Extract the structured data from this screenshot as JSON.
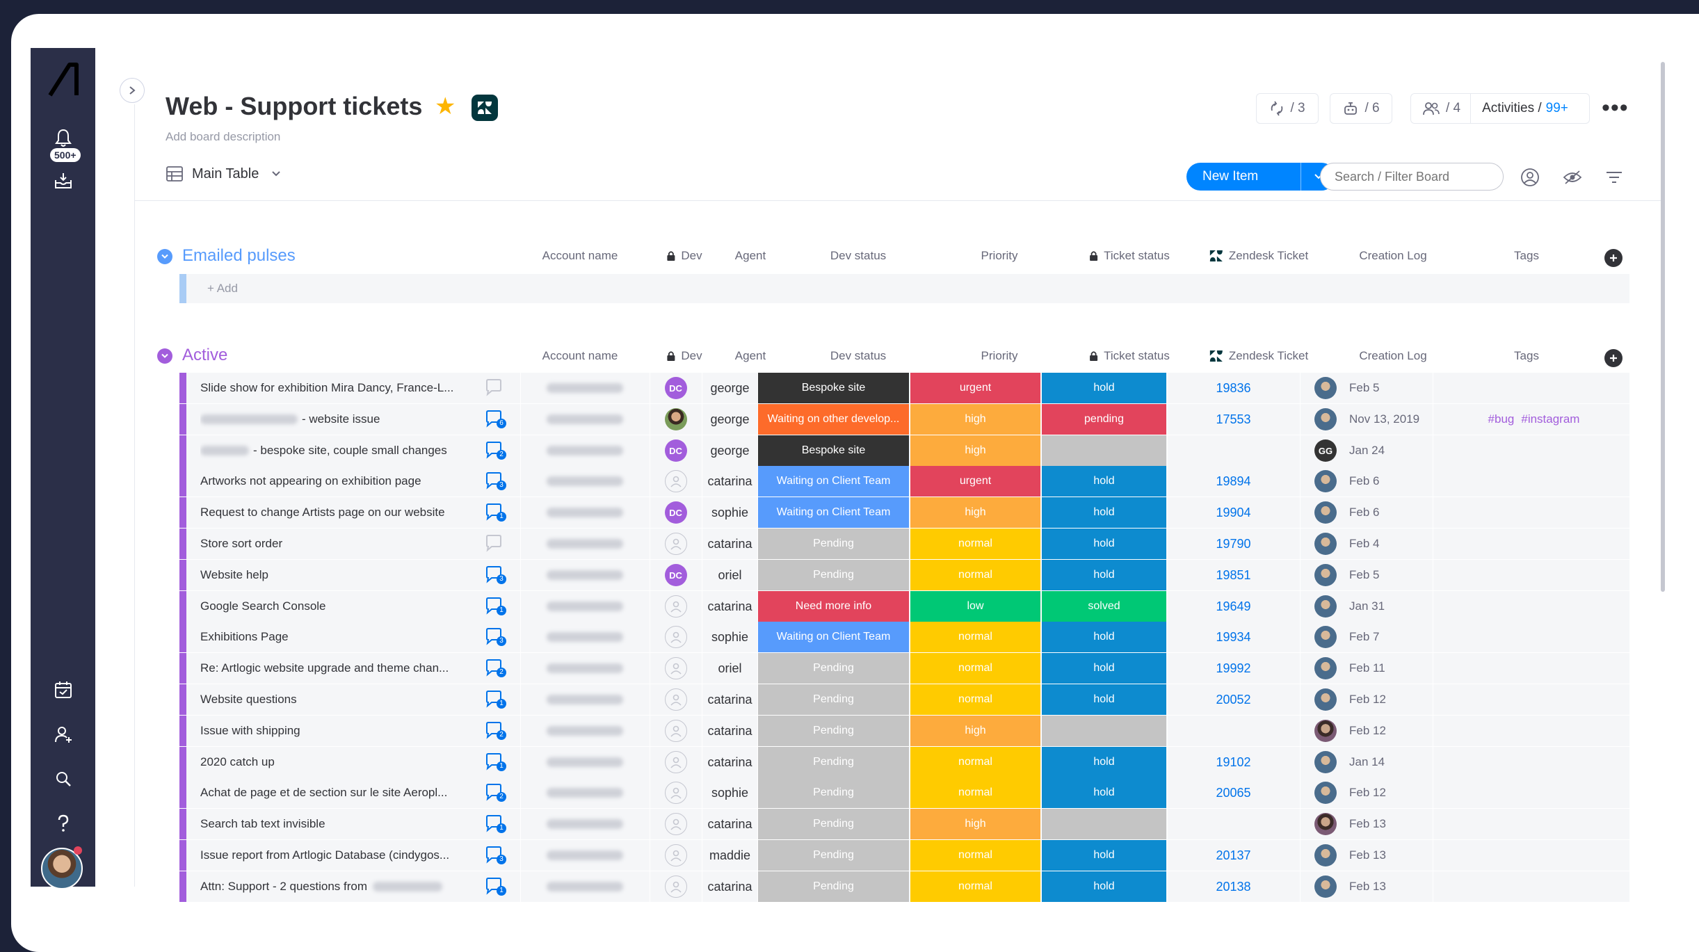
{
  "board": {
    "title": "Web - Support tickets",
    "description_placeholder": "Add board description"
  },
  "nav": {
    "inbox_badge": "500+"
  },
  "header_counters": {
    "automations": "/ 3",
    "integrations": "/ 6",
    "members": "/ 4",
    "activities_label": "Activities /",
    "activities_count": "99+"
  },
  "view": {
    "name": "Main Table"
  },
  "toolbar": {
    "new_item_label": "New Item",
    "search_placeholder": "Search / Filter Board"
  },
  "columns": [
    "Account name",
    "Dev",
    "Agent",
    "Dev status",
    "Priority",
    "Ticket status",
    "Zendesk Ticket",
    "Creation Log",
    "Tags"
  ],
  "groups": [
    {
      "name": "Emailed pulses",
      "color": "#579bfc",
      "add_label": "+ Add"
    },
    {
      "name": "Active",
      "color": "#a25ddc"
    }
  ],
  "colors": {
    "Bespoke site": "#333333",
    "Waiting on other develop...": "#fd6b2a",
    "Waiting on Client Team": "#579bfc",
    "Pending": "#c4c4c4",
    "Need more info": "#e2445c",
    "urgent": "#e2445c",
    "high": "#fdab3d",
    "normal": "#ffcb00",
    "low": "#00c875",
    "hold": "#0d8bcf",
    "pending": "#e2445c",
    "solved": "#00c875"
  },
  "rows": [
    {
      "name": "Slide show for exhibition Mira Dancy, France-L...",
      "updates": "",
      "dev": "DC",
      "agent": "george",
      "dev_status": "Bespoke site",
      "priority": "urgent",
      "ticket_status": "hold",
      "zendesk": "19836",
      "log_avatar": "photo",
      "log_date": "Feb 5",
      "tags": []
    },
    {
      "name": "- website issue",
      "name_blur": "before",
      "updates": "6",
      "dev": "photo",
      "agent": "george",
      "dev_status": "Waiting on other develop...",
      "priority": "high",
      "ticket_status": "pending",
      "zendesk": "17553",
      "log_avatar": "photo",
      "log_date": "Nov 13, 2019",
      "tags": [
        "#bug",
        "#instagram"
      ]
    },
    {
      "name": "- bespoke site, couple small changes",
      "name_blur": "before-sm",
      "updates": "2",
      "dev": "DC",
      "agent": "george",
      "dev_status": "Bespoke site",
      "priority": "high",
      "ticket_status": "",
      "zendesk": "",
      "log_avatar": "GG",
      "log_date": "Jan 24",
      "tags": []
    },
    {
      "name": "Artworks not appearing on exhibition page",
      "updates": "3",
      "dev": "",
      "agent": "catarina",
      "dev_status": "Waiting on Client Team",
      "priority": "urgent",
      "ticket_status": "hold",
      "zendesk": "19894",
      "log_avatar": "photo",
      "log_date": "Feb 6",
      "tags": []
    },
    {
      "name": "Request to change Artists page on our website",
      "updates": "1",
      "dev": "DC",
      "agent": "sophie",
      "dev_status": "Waiting on Client Team",
      "priority": "high",
      "ticket_status": "hold",
      "zendesk": "19904",
      "log_avatar": "photo",
      "log_date": "Feb 6",
      "tags": []
    },
    {
      "name": "Store sort order",
      "updates": "",
      "dev": "",
      "agent": "catarina",
      "dev_status": "Pending",
      "priority": "normal",
      "ticket_status": "hold",
      "zendesk": "19790",
      "log_avatar": "photo",
      "log_date": "Feb 4",
      "tags": []
    },
    {
      "name": "Website help",
      "updates": "3",
      "dev": "DC",
      "agent": "oriel",
      "dev_status": "Pending",
      "priority": "normal",
      "ticket_status": "hold",
      "zendesk": "19851",
      "log_avatar": "photo",
      "log_date": "Feb 5",
      "tags": []
    },
    {
      "name": "Google Search Console",
      "updates": "1",
      "dev": "",
      "agent": "catarina",
      "dev_status": "Need more info",
      "priority": "low",
      "ticket_status": "solved",
      "zendesk": "19649",
      "log_avatar": "photo",
      "log_date": "Jan 31",
      "tags": []
    },
    {
      "name": "Exhibitions Page",
      "updates": "3",
      "dev": "",
      "agent": "sophie",
      "dev_status": "Waiting on Client Team",
      "priority": "normal",
      "ticket_status": "hold",
      "zendesk": "19934",
      "log_avatar": "photo",
      "log_date": "Feb 7",
      "tags": []
    },
    {
      "name": "Re: Artlogic website upgrade and theme chan...",
      "updates": "2",
      "dev": "",
      "agent": "oriel",
      "dev_status": "Pending",
      "priority": "normal",
      "ticket_status": "hold",
      "zendesk": "19992",
      "log_avatar": "photo",
      "log_date": "Feb 11",
      "tags": []
    },
    {
      "name": "Website questions",
      "updates": "1",
      "dev": "",
      "agent": "catarina",
      "dev_status": "Pending",
      "priority": "normal",
      "ticket_status": "hold",
      "zendesk": "20052",
      "log_avatar": "photo",
      "log_date": "Feb 12",
      "tags": []
    },
    {
      "name": "Issue with shipping",
      "updates": "2",
      "dev": "",
      "agent": "catarina",
      "dev_status": "Pending",
      "priority": "high",
      "ticket_status": "",
      "zendesk": "",
      "log_avatar": "alt",
      "log_date": "Feb 12",
      "tags": []
    },
    {
      "name": "2020 catch up",
      "updates": "1",
      "dev": "",
      "agent": "catarina",
      "dev_status": "Pending",
      "priority": "normal",
      "ticket_status": "hold",
      "zendesk": "19102",
      "log_avatar": "photo",
      "log_date": "Jan 14",
      "tags": []
    },
    {
      "name": "Achat de page et de section sur le site Aeropl...",
      "updates": "2",
      "dev": "",
      "agent": "sophie",
      "dev_status": "Pending",
      "priority": "normal",
      "ticket_status": "hold",
      "zendesk": "20065",
      "log_avatar": "photo",
      "log_date": "Feb 12",
      "tags": []
    },
    {
      "name": "Search tab text invisible",
      "updates": "1",
      "dev": "",
      "agent": "catarina",
      "dev_status": "Pending",
      "priority": "high",
      "ticket_status": "",
      "zendesk": "",
      "log_avatar": "alt",
      "log_date": "Feb 13",
      "tags": []
    },
    {
      "name": "Issue report from Artlogic Database (cindygos...",
      "updates": "3",
      "dev": "",
      "agent": "maddie",
      "dev_status": "Pending",
      "priority": "normal",
      "ticket_status": "hold",
      "zendesk": "20137",
      "log_avatar": "photo",
      "log_date": "Feb 13",
      "tags": []
    },
    {
      "name": "Attn: Support - 2 questions from",
      "name_blur": "after",
      "updates": "1",
      "dev": "",
      "agent": "catarina",
      "dev_status": "Pending",
      "priority": "normal",
      "ticket_status": "hold",
      "zendesk": "20138",
      "log_avatar": "photo",
      "log_date": "Feb 13",
      "tags": []
    }
  ]
}
